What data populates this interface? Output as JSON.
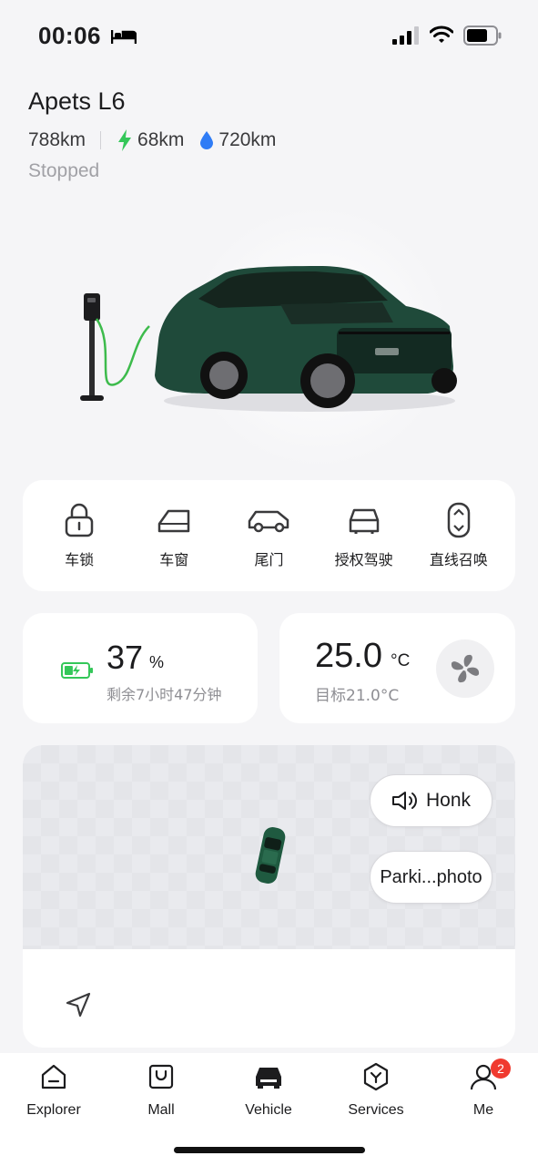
{
  "status_bar": {
    "time": "00:06",
    "icons": [
      "bed-icon",
      "signal-icon",
      "wifi-icon",
      "battery-icon"
    ]
  },
  "vehicle": {
    "name": "Apets L6",
    "range_total": "788km",
    "range_electric": "68km",
    "range_fuel": "720km",
    "status": "Stopped",
    "body_color": "#1f4a3a",
    "electric_color": "#34c759",
    "fuel_color": "#2f7cf6"
  },
  "controls": [
    {
      "label": "车锁",
      "icon": "lock-icon"
    },
    {
      "label": "车窗",
      "icon": "window-icon"
    },
    {
      "label": "尾门",
      "icon": "tailgate-icon"
    },
    {
      "label": "授权驾驶",
      "icon": "authorized-drive-icon"
    },
    {
      "label": "直线召唤",
      "icon": "straight-summon-icon"
    }
  ],
  "battery": {
    "value": "37",
    "unit": "%",
    "remaining": "剩余7小时47分钟",
    "level": 0.37
  },
  "climate": {
    "temperature": "25.0",
    "unit": "°C",
    "target": "目标21.0°C"
  },
  "map": {
    "honk_label": "Honk",
    "parking_photo_label": "Parki...photo"
  },
  "nav": {
    "items": [
      {
        "label": "Explorer",
        "icon": "explorer-icon"
      },
      {
        "label": "Mall",
        "icon": "mall-icon"
      },
      {
        "label": "Vehicle",
        "icon": "vehicle-icon"
      },
      {
        "label": "Services",
        "icon": "services-icon"
      },
      {
        "label": "Me",
        "icon": "me-icon"
      }
    ],
    "me_badge": "2",
    "active": "Vehicle"
  }
}
